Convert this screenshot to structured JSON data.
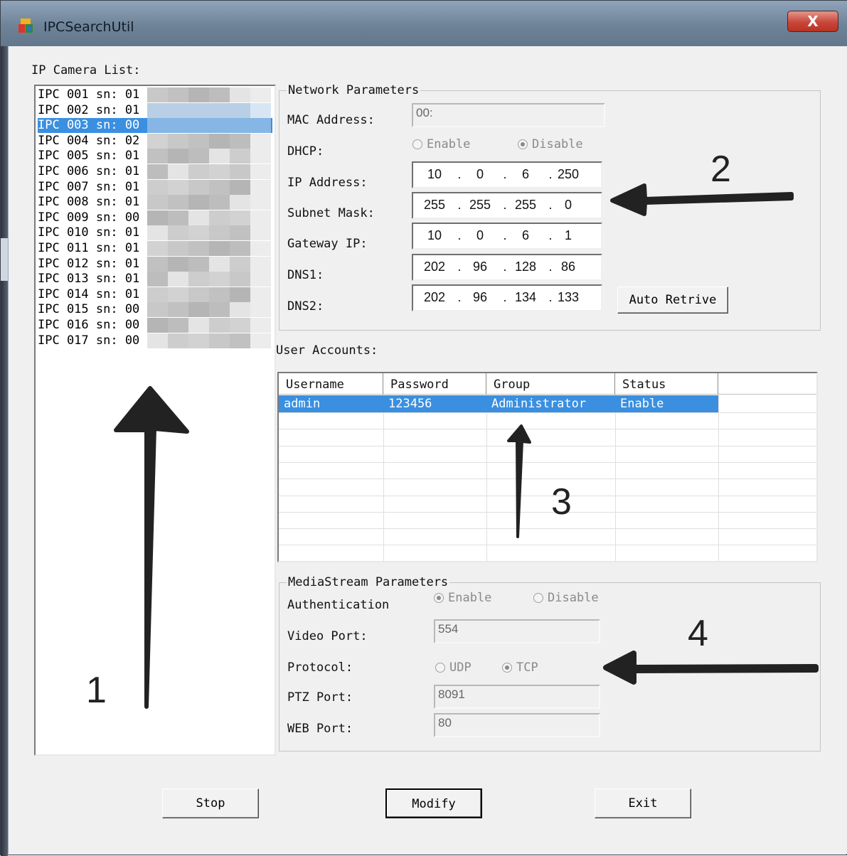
{
  "window": {
    "title": "IPCSearchUtil",
    "close_label": "X"
  },
  "camera_list": {
    "label": "IP Camera List:",
    "items": [
      "IPC 001 sn: 01",
      "IPC 002 sn: 01",
      "IPC 003 sn: 00",
      "IPC 004 sn: 02",
      "IPC 005 sn: 01",
      "IPC 006 sn: 01",
      "IPC 007 sn: 01",
      "IPC 008 sn: 01",
      "IPC 009 sn: 00",
      "IPC 010 sn: 01",
      "IPC 011 sn: 01",
      "IPC 012 sn: 01",
      "IPC 013 sn: 01",
      "IPC 014 sn: 01",
      "IPC 015 sn: 00",
      "IPC 016 sn: 00",
      "IPC 017 sn: 00"
    ],
    "selected_index": 2
  },
  "network": {
    "legend": "Network Parameters",
    "mac_label": "MAC Address:",
    "mac_value": "00:",
    "dhcp_label": "DHCP:",
    "dhcp_enable": "Enable",
    "dhcp_disable": "Disable",
    "dhcp_selected": "Disable",
    "ip_label": "IP Address:",
    "ip": [
      "10",
      "0",
      "6",
      "250"
    ],
    "subnet_label": "Subnet Mask:",
    "subnet": [
      "255",
      "255",
      "255",
      "0"
    ],
    "gateway_label": "Gateway IP:",
    "gateway": [
      "10",
      "0",
      "6",
      "1"
    ],
    "dns1_label": "DNS1:",
    "dns1": [
      "202",
      "96",
      "128",
      "86"
    ],
    "dns2_label": "DNS2:",
    "dns2": [
      "202",
      "96",
      "134",
      "133"
    ],
    "auto_retrive_label": "Auto Retrive"
  },
  "accounts": {
    "label": "User Accounts:",
    "columns": [
      "Username",
      "Password",
      "Group",
      "Status"
    ],
    "rows": [
      [
        "admin",
        "123456",
        "Administrator",
        "Enable"
      ]
    ]
  },
  "media": {
    "legend": "MediaStream Parameters",
    "auth_label": "Authentication",
    "auth_enable": "Enable",
    "auth_disable": "Disable",
    "auth_selected": "Enable",
    "video_port_label": "Video Port:",
    "video_port": "554",
    "protocol_label": "Protocol:",
    "protocol_udp": "UDP",
    "protocol_tcp": "TCP",
    "protocol_selected": "TCP",
    "ptz_port_label": "PTZ Port:",
    "ptz_port": "8091",
    "web_port_label": "WEB Port:",
    "web_port": "80"
  },
  "buttons": {
    "stop": "Stop",
    "modify": "Modify",
    "exit": "Exit"
  },
  "annotations": [
    "1",
    "2",
    "3",
    "4"
  ],
  "colors": {
    "selection": "#3a8fe0",
    "arrow": "#222222"
  }
}
